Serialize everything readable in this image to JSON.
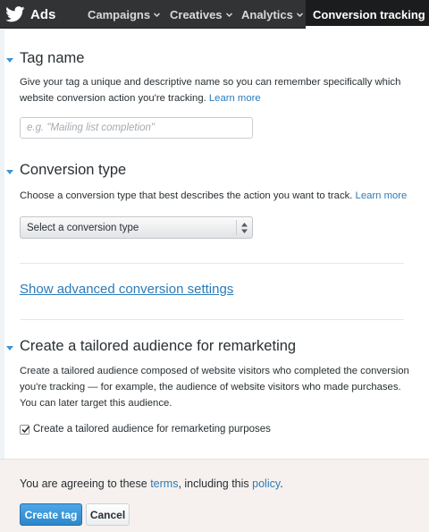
{
  "nav": {
    "brand": "Ads",
    "items": [
      {
        "label": "Campaigns"
      },
      {
        "label": "Creatives"
      },
      {
        "label": "Analytics"
      }
    ],
    "active": "Conversion tracking"
  },
  "tag_name": {
    "title": "Tag name",
    "desc": "Give your tag a unique and descriptive name so you can remember specifically which website conversion action you're tracking.",
    "link": "Learn more",
    "placeholder": "e.g. \"Mailing list completion\"",
    "value": ""
  },
  "conversion_type": {
    "title": "Conversion type",
    "desc": "Choose a conversion type that best describes the action you want to track.",
    "link": "Learn more",
    "selected": "Select a conversion type"
  },
  "advanced": {
    "label": "Show advanced conversion settings"
  },
  "audience": {
    "title": "Create a tailored audience for remarketing",
    "desc": "Create a tailored audience composed of website visitors who completed the conversion you're tracking — for example, the audience of website visitors who made purchases. You can later target this audience.",
    "checkbox_label": "Create a tailored audience for remarketing purposes",
    "checked": true
  },
  "footer": {
    "agree_prefix": "You are agreeing to these",
    "terms": "terms",
    "middle": ", including this",
    "policy": "policy",
    "suffix": ".",
    "create_label": "Create tag",
    "cancel_label": "Cancel"
  },
  "colors": {
    "nav_bg": "#323335",
    "link": "#2b7bb9",
    "primary_button": "#2b86cb",
    "footer_bg": "#f6f1ef"
  },
  "icons": {
    "brand": "twitter-bird-icon",
    "nav_chevron": "chevron-down-icon",
    "section_toggle": "caret-down-icon",
    "select_arrows": "select-arrows-icon",
    "checkbox": "checkmark-icon"
  }
}
